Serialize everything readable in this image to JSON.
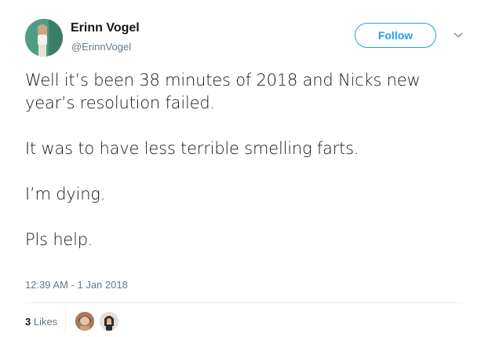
{
  "author": {
    "name": "Erinn Vogel",
    "handle": "@ErinnVogel"
  },
  "actions": {
    "follow_label": "Follow",
    "more_icon": "chevron-down-icon"
  },
  "tweet": {
    "paragraphs": [
      "Well it’s been 38 minutes of 2018 and Nicks new year’s resolution failed.",
      "It was to have less terrible smelling farts.",
      "I’m dying.",
      "Pls help."
    ],
    "timestamp": "12:39 AM - 1 Jan 2018"
  },
  "engagement": {
    "likes_count": "3",
    "likes_label": "Likes"
  },
  "colors": {
    "accent": "#1da1f2",
    "text": "#14171a",
    "muted": "#657786",
    "divider": "#e6ecf0"
  }
}
